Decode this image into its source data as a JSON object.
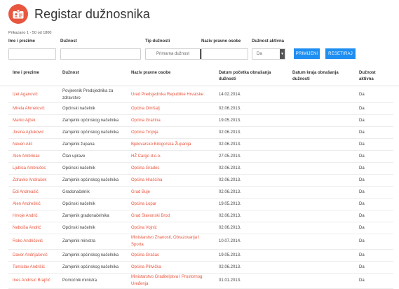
{
  "header": {
    "title": "Registar dužnosnika",
    "count_text": "Prikazano 1 - 50 od 1800"
  },
  "filters": {
    "name_label": "Ime i prezime",
    "name_value": "",
    "position_label": "Dužnost",
    "position_value": "",
    "type_label": "Tip dužnosti",
    "type_selected": "Primarna dužnost",
    "body_label": "Naziv pravne osobe",
    "body_value": "",
    "active_label": "Dužnost aktivna",
    "active_selected": "Da",
    "apply_label": "PRIMIJENI",
    "reset_label": "RESETIRAJ"
  },
  "table": {
    "headers": {
      "name": "Ime i prezime",
      "position": "Dužnost",
      "body": "Naziv pravne osobe",
      "start": "Datum početka obnašanja dužnosti",
      "end": "Datum kraja obnašanja dužnosti",
      "active": "Dužnost aktivna"
    },
    "rows": [
      {
        "name": "Izet Aganović",
        "position": "Povjerenik Predsjednika za zdravstvo",
        "body": "Ured Predsjednika Republike Hrvatske",
        "start": "14.02.2014.",
        "end": "",
        "active": "Da"
      },
      {
        "name": "Mirela Ahmetović",
        "position": "Općinski načelnik",
        "body": "Općina Omišalj",
        "start": "02.06.2013.",
        "end": "",
        "active": "Da"
      },
      {
        "name": "Marko Ajček",
        "position": "Zamjenik općinskog načelnika",
        "body": "Općina Gračina",
        "start": "19.05.2013.",
        "end": "",
        "active": "Da"
      },
      {
        "name": "Josina Ajduković",
        "position": "Zamjenik općinskog načelnika",
        "body": "Općina Trojnja",
        "start": "02.06.2013.",
        "end": "",
        "active": "Da"
      },
      {
        "name": "Neven Alić",
        "position": "Zamjenik župana",
        "body": "Bjelovarsko Bilogorska Županija",
        "start": "02.06.2013.",
        "end": "",
        "active": "Da"
      },
      {
        "name": "Alen Ambrinac",
        "position": "Član uprave",
        "body": "HŽ Cargo d.o.o.",
        "start": "27.05.2014.",
        "end": "",
        "active": "Da"
      },
      {
        "name": "Ljubica Ambrušec",
        "position": "Općinski načelnik",
        "body": "Općina Gradec",
        "start": "02.06.2013.",
        "end": "",
        "active": "Da"
      },
      {
        "name": "Zdravko Andrašek",
        "position": "Zamjenik općinskog načelnika",
        "body": "Općina Hrašćina",
        "start": "02.06.2013.",
        "end": "",
        "active": "Da"
      },
      {
        "name": "Edi Andreašić",
        "position": "Gradonačelnik",
        "body": "Grad Buje",
        "start": "02.06.2013.",
        "end": "",
        "active": "Da"
      },
      {
        "name": "Alen Andreškić",
        "position": "Općinski načelnik",
        "body": "Općina Lopar",
        "start": "19.05.2013.",
        "end": "",
        "active": "Da"
      },
      {
        "name": "Hrvoje Andrić",
        "position": "Zamjenik gradonačelnika",
        "body": "Grad Slavonski Brod",
        "start": "02.06.2013.",
        "end": "",
        "active": "Da"
      },
      {
        "name": "Neboiša Andrić",
        "position": "Općinski načelnik",
        "body": "Općina Vojnić",
        "start": "02.06.2013.",
        "end": "",
        "active": "Da"
      },
      {
        "name": "Roko Andričević",
        "position": "Zamjenik ministra",
        "body": "Ministarstvo Znanosti, Obrazovanja I Sporta",
        "start": "10.07.2014.",
        "end": "",
        "active": "Da"
      },
      {
        "name": "Davor Andrijašević",
        "position": "Zamjenik općinskog načelnika",
        "body": "Općina Gračac",
        "start": "19.05.2013.",
        "end": "",
        "active": "Da"
      },
      {
        "name": "Tomislav Andrišić",
        "position": "Zamjenik općinskog načelnika",
        "body": "Općina Plitvička",
        "start": "02.06.2013.",
        "end": "",
        "active": "Da"
      },
      {
        "name": "Ines Andrisic Brajčić",
        "position": "Pomoćnik ministra",
        "body": "Ministarstvo Graditeljstva I Prostornog Uređenja",
        "start": "01.01.2013.",
        "end": "",
        "active": "Da"
      }
    ]
  },
  "colors": {
    "accent": "#e8563f",
    "button": "#1f8ef1"
  }
}
